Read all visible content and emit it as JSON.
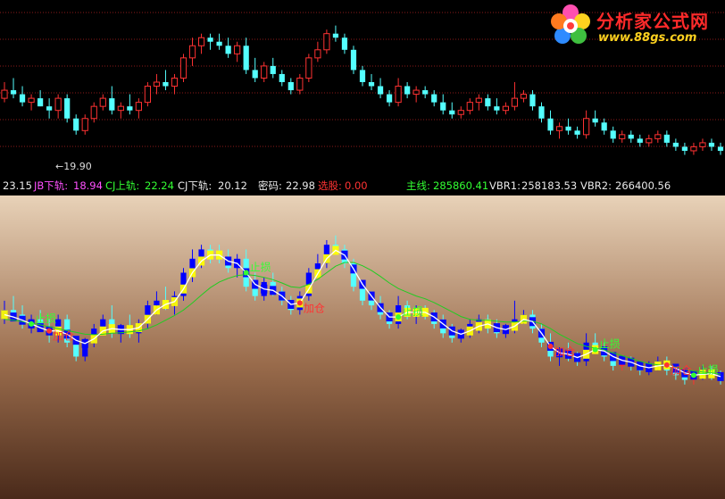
{
  "info_bar": {
    "first_value": "23.15",
    "jb_label": "JB下轨:",
    "jb_value": "18.94",
    "cj_up_label": "CJ上轨:",
    "cj_up_value": "22.24",
    "cj_down_label": "CJ下轨:",
    "cj_down_value": "20.12",
    "mima_label": "密码:",
    "mima_value": "22.98",
    "xuangu_label": "选股:",
    "xuangu_value": "0.00",
    "zhuxian_label": "主线:",
    "zhuxian_value": "285860.41",
    "vbr1_label": "VBR1:",
    "vbr1_value": "258183.53",
    "vbr2_label": "VBR2:",
    "vbr2_value": "266400.56"
  },
  "logo": {
    "title": "分析家公式网",
    "url": "www.88gs.com"
  },
  "colors": {
    "up_candle": "#ff3232",
    "down_candle": "#54ffff",
    "grid": "#8b1a1a",
    "band_up": "#ffff00",
    "band_down": "#0000ff",
    "mid_line": "#ffffff",
    "slow_line": "#22cc22",
    "signal_text_green": "#33ff33",
    "signal_text_red": "#ff3333"
  },
  "chart_data": [
    {
      "type": "candlestick",
      "name": "price",
      "low_marker": "←19.90",
      "candles": [
        [
          20.8,
          21.2,
          20.7,
          21.0
        ],
        [
          21.0,
          21.3,
          20.8,
          20.9
        ],
        [
          20.9,
          21.1,
          20.6,
          20.7
        ],
        [
          20.7,
          20.9,
          20.5,
          20.8
        ],
        [
          20.8,
          21.0,
          20.6,
          20.6
        ],
        [
          20.6,
          20.8,
          20.3,
          20.5
        ],
        [
          20.5,
          20.9,
          20.3,
          20.8
        ],
        [
          20.8,
          20.9,
          20.2,
          20.3
        ],
        [
          20.3,
          20.4,
          19.9,
          20.0
        ],
        [
          20.0,
          20.4,
          19.9,
          20.3
        ],
        [
          20.3,
          20.7,
          20.2,
          20.6
        ],
        [
          20.6,
          20.9,
          20.5,
          20.8
        ],
        [
          20.8,
          21.1,
          20.4,
          20.5
        ],
        [
          20.5,
          20.7,
          20.3,
          20.6
        ],
        [
          20.6,
          20.9,
          20.4,
          20.5
        ],
        [
          20.5,
          20.8,
          20.3,
          20.7
        ],
        [
          20.7,
          21.2,
          20.6,
          21.1
        ],
        [
          21.1,
          21.4,
          20.9,
          21.2
        ],
        [
          21.2,
          21.5,
          21.0,
          21.1
        ],
        [
          21.1,
          21.4,
          20.9,
          21.3
        ],
        [
          21.3,
          21.9,
          21.2,
          21.8
        ],
        [
          21.8,
          22.3,
          21.6,
          22.1
        ],
        [
          22.1,
          22.4,
          21.9,
          22.3
        ],
        [
          22.3,
          22.4,
          22.0,
          22.2
        ],
        [
          22.2,
          22.4,
          22.0,
          22.1
        ],
        [
          22.1,
          22.3,
          21.8,
          21.9
        ],
        [
          21.9,
          22.2,
          21.7,
          22.1
        ],
        [
          22.1,
          22.3,
          21.4,
          21.5
        ],
        [
          21.5,
          21.8,
          21.2,
          21.3
        ],
        [
          21.3,
          21.7,
          21.2,
          21.6
        ],
        [
          21.6,
          21.8,
          21.3,
          21.4
        ],
        [
          21.4,
          21.5,
          21.1,
          21.2
        ],
        [
          21.2,
          21.3,
          20.9,
          21.0
        ],
        [
          21.0,
          21.4,
          20.9,
          21.3
        ],
        [
          21.3,
          21.9,
          21.2,
          21.8
        ],
        [
          21.8,
          22.2,
          21.7,
          22.0
        ],
        [
          22.0,
          22.5,
          21.9,
          22.4
        ],
        [
          22.4,
          22.6,
          22.2,
          22.3
        ],
        [
          22.3,
          22.4,
          21.9,
          22.0
        ],
        [
          22.0,
          22.1,
          21.4,
          21.5
        ],
        [
          21.5,
          21.6,
          21.1,
          21.2
        ],
        [
          21.2,
          21.4,
          21.0,
          21.1
        ],
        [
          21.1,
          21.3,
          20.8,
          20.9
        ],
        [
          20.9,
          21.0,
          20.6,
          20.7
        ],
        [
          20.7,
          21.3,
          20.6,
          21.1
        ],
        [
          21.1,
          21.2,
          20.8,
          20.9
        ],
        [
          20.9,
          21.1,
          20.7,
          21.0
        ],
        [
          21.0,
          21.1,
          20.8,
          20.9
        ],
        [
          20.9,
          21.0,
          20.6,
          20.7
        ],
        [
          20.7,
          20.9,
          20.4,
          20.5
        ],
        [
          20.5,
          20.7,
          20.3,
          20.4
        ],
        [
          20.4,
          20.6,
          20.3,
          20.5
        ],
        [
          20.5,
          20.8,
          20.4,
          20.7
        ],
        [
          20.7,
          20.9,
          20.5,
          20.8
        ],
        [
          20.8,
          20.9,
          20.5,
          20.6
        ],
        [
          20.6,
          20.8,
          20.4,
          20.5
        ],
        [
          20.5,
          20.7,
          20.4,
          20.6
        ],
        [
          20.6,
          21.2,
          20.5,
          20.8
        ],
        [
          20.8,
          21.0,
          20.7,
          20.9
        ],
        [
          20.9,
          21.0,
          20.5,
          20.6
        ],
        [
          20.6,
          20.7,
          20.2,
          20.3
        ],
        [
          20.3,
          20.5,
          19.9,
          20.0
        ],
        [
          20.0,
          20.2,
          19.8,
          20.1
        ],
        [
          20.1,
          20.3,
          19.9,
          20.0
        ],
        [
          20.0,
          20.1,
          19.8,
          19.9
        ],
        [
          19.9,
          20.5,
          19.8,
          20.3
        ],
        [
          20.3,
          20.5,
          20.1,
          20.2
        ],
        [
          20.2,
          20.3,
          19.9,
          20.0
        ],
        [
          20.0,
          20.1,
          19.7,
          19.8
        ],
        [
          19.8,
          20.0,
          19.7,
          19.9
        ],
        [
          19.9,
          20.0,
          19.7,
          19.8
        ],
        [
          19.8,
          19.9,
          19.6,
          19.7
        ],
        [
          19.7,
          19.9,
          19.6,
          19.8
        ],
        [
          19.8,
          20.0,
          19.7,
          19.9
        ],
        [
          19.9,
          20.0,
          19.6,
          19.7
        ],
        [
          19.7,
          19.8,
          19.5,
          19.6
        ],
        [
          19.6,
          19.7,
          19.4,
          19.5
        ],
        [
          19.5,
          19.7,
          19.4,
          19.6
        ],
        [
          19.6,
          19.8,
          19.5,
          19.7
        ],
        [
          19.7,
          19.8,
          19.5,
          19.6
        ],
        [
          19.6,
          19.7,
          19.4,
          19.5
        ]
      ],
      "y_domain": [
        19.3,
        23.1
      ]
    },
    {
      "type": "line",
      "name": "indicator",
      "series": [
        {
          "key": "band_mid",
          "values": [
            20.9,
            20.85,
            20.78,
            20.7,
            20.62,
            20.55,
            20.55,
            20.48,
            20.35,
            20.28,
            20.38,
            20.55,
            20.6,
            20.58,
            20.58,
            20.62,
            20.8,
            21.0,
            21.12,
            21.18,
            21.45,
            21.8,
            22.05,
            22.18,
            22.18,
            22.05,
            22.0,
            21.8,
            21.55,
            21.45,
            21.42,
            21.3,
            21.12,
            21.15,
            21.45,
            21.78,
            22.1,
            22.28,
            22.18,
            21.88,
            21.55,
            21.3,
            21.05,
            20.85,
            20.85,
            20.95,
            20.95,
            20.95,
            20.85,
            20.7,
            20.55,
            20.48,
            20.55,
            20.65,
            20.7,
            20.62,
            20.58,
            20.65,
            20.8,
            20.75,
            20.5,
            20.22,
            20.08,
            20.05,
            19.98,
            20.05,
            20.15,
            20.12,
            20.0,
            19.92,
            19.88,
            19.8,
            19.76,
            19.8,
            19.82,
            19.75,
            19.65,
            19.6,
            19.62,
            19.63,
            19.57
          ]
        },
        {
          "key": "slow_line",
          "values": [
            20.8,
            20.78,
            20.75,
            20.72,
            20.68,
            20.64,
            20.6,
            20.56,
            20.52,
            20.48,
            20.47,
            20.48,
            20.5,
            20.51,
            20.53,
            20.55,
            20.6,
            20.68,
            20.78,
            20.88,
            21.0,
            21.15,
            21.32,
            21.48,
            21.6,
            21.68,
            21.74,
            21.76,
            21.74,
            21.7,
            21.65,
            21.58,
            21.5,
            21.48,
            21.55,
            21.66,
            21.8,
            21.94,
            22.02,
            22.02,
            21.95,
            21.85,
            21.72,
            21.58,
            21.46,
            21.38,
            21.3,
            21.24,
            21.16,
            21.06,
            20.96,
            20.86,
            20.8,
            20.78,
            20.78,
            20.76,
            20.74,
            20.74,
            20.76,
            20.76,
            20.7,
            20.6,
            20.48,
            20.38,
            20.28,
            20.22,
            20.18,
            20.14,
            20.08,
            20.02,
            19.96,
            19.9,
            19.85,
            19.82,
            19.8,
            19.77,
            19.73,
            19.69,
            19.67,
            19.65,
            19.62
          ]
        }
      ],
      "signals": [
        {
          "index": 5,
          "text": "加仓"
        },
        {
          "index": 3,
          "text": "止损"
        },
        {
          "index": 27,
          "text": "止损"
        },
        {
          "index": 33,
          "text": "加仓"
        },
        {
          "index": 44,
          "text": "止损"
        },
        {
          "index": 61,
          "text": "加仓"
        },
        {
          "index": 66,
          "text": "止损"
        },
        {
          "index": 74,
          "text": "加仓"
        },
        {
          "index": 77,
          "text": "止损"
        }
      ],
      "y_domain": [
        17.0,
        23.4
      ]
    }
  ]
}
